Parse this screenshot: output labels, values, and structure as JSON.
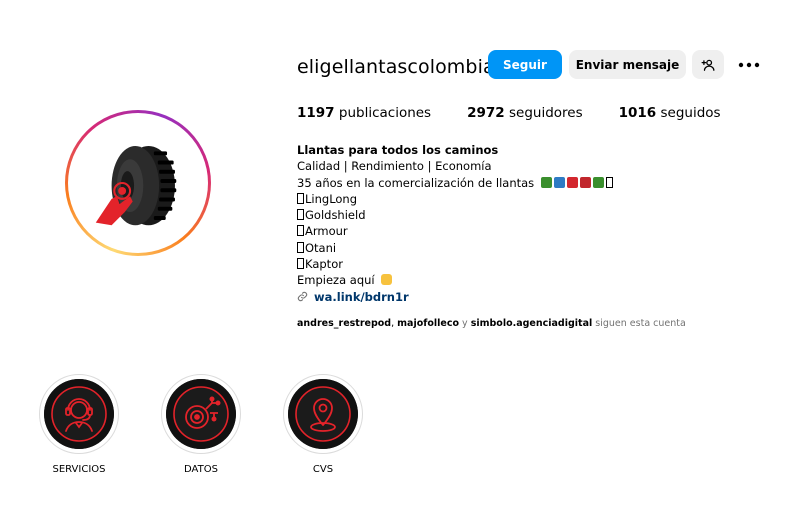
{
  "profile": {
    "username": "eligellantascolombia",
    "follow_label": "Seguir",
    "message_label": "Enviar mensaje",
    "add_user_icon": "person-add-icon",
    "more_icon": "ellipsis-icon"
  },
  "stats": {
    "posts_count": "1197",
    "posts_label": "publicaciones",
    "followers_count": "2972",
    "followers_label": "seguidores",
    "following_count": "1016",
    "following_label": "seguidos"
  },
  "bio": {
    "name": "Llantas para todos los caminos",
    "line1": "Calidad | Rendimiento | Economía",
    "line2": "35 años en la comercialización de llantas",
    "brand1": "LingLong",
    "brand2": "Goldshield",
    "brand3": "Armour",
    "brand4": "Otani",
    "brand5": "Kaptor",
    "cta": "Empieza aquí",
    "link": "wa.link/bdrn1r"
  },
  "followed_by": {
    "user1": "andres_restrepod",
    "sep1": ", ",
    "user2": "majofolleco",
    "and": " y ",
    "user3": "simbolo.agenciadigital",
    "suffix": " siguen esta cuenta"
  },
  "highlights": [
    {
      "label": "SERVICIOS",
      "icon": "headset-agent-icon"
    },
    {
      "label": "DATOS",
      "icon": "tire-data-icon"
    },
    {
      "label": "CVS",
      "icon": "location-pin-icon"
    }
  ],
  "colors": {
    "follow_button": "#0095f6",
    "secondary_button": "#efefef",
    "link": "#00376b",
    "muted": "#737373",
    "highlight_accent": "#e3232a"
  }
}
